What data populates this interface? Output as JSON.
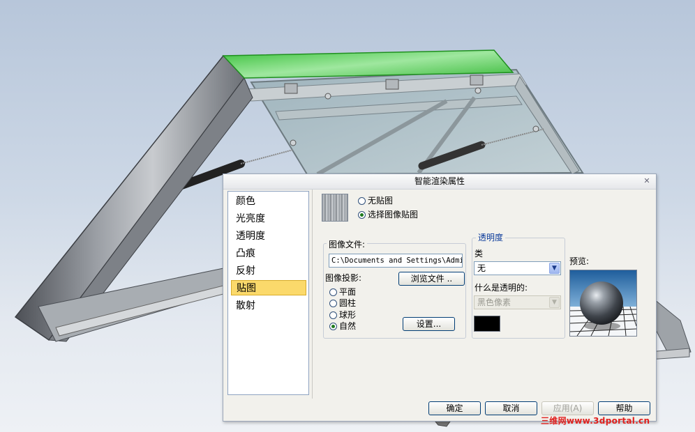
{
  "dialog": {
    "title": "智能渲染属性",
    "close_glyph": "✕"
  },
  "categories": [
    {
      "label": "颜色",
      "selected": false
    },
    {
      "label": "光亮度",
      "selected": false
    },
    {
      "label": "透明度",
      "selected": false
    },
    {
      "label": "凸痕",
      "selected": false
    },
    {
      "label": "反射",
      "selected": false
    },
    {
      "label": "贴图",
      "selected": true
    },
    {
      "label": "散射",
      "selected": false
    }
  ],
  "texture_mode": {
    "no_texture_label": "无贴图",
    "image_texture_label": "选择图像贴图",
    "selected": "image_texture"
  },
  "image_file": {
    "group_label": "图像文件:",
    "path_value": "C:\\Documents and Settings\\Admin",
    "browse_label": "浏览文件 ..",
    "projection_label": "图像投影:",
    "projections": [
      "平面",
      "圆柱",
      "球形",
      "自然"
    ],
    "projection_selected": "自然",
    "settings_label": "设置..."
  },
  "transparency": {
    "group_label": "透明度",
    "type_label": "类",
    "type_value": "无",
    "what_label": "什么是透明的:",
    "what_value": "黑色像素",
    "color": "#000000"
  },
  "preview_label": "预览:",
  "footer": {
    "ok_label": "确定",
    "cancel_label": "取消",
    "apply_label": "应用(A)",
    "help_label": "帮助"
  },
  "colors": {
    "highlight_edge": "#3fd13f",
    "selection": "#fbd96b",
    "watermark": "#e0201e"
  },
  "watermark": "三维网www.3dportal.cn"
}
